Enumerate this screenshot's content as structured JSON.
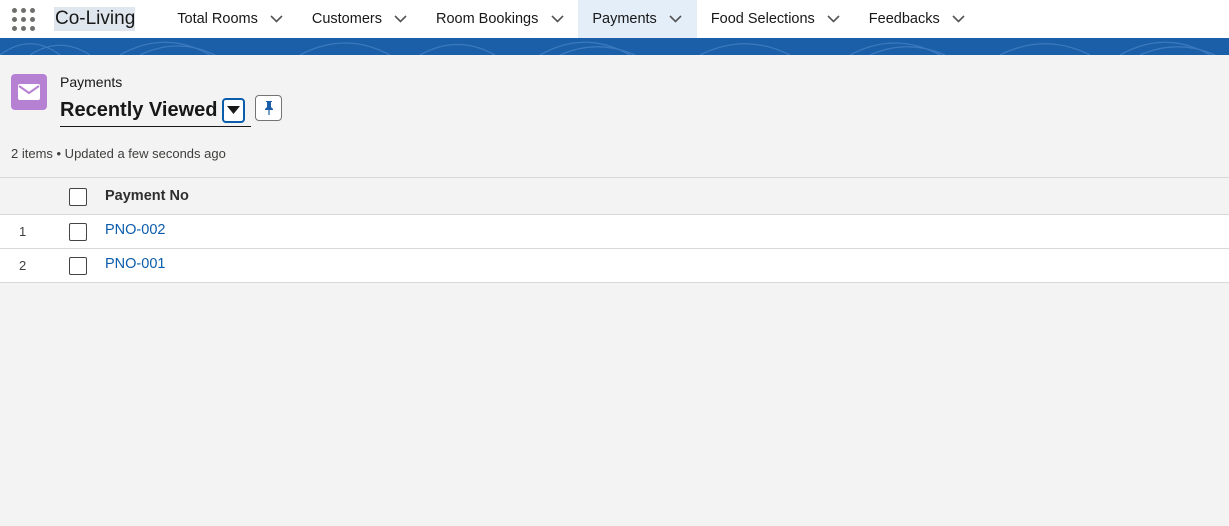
{
  "app": {
    "name": "Co-Living",
    "launcher_icon": "app-launcher-grid-icon"
  },
  "nav": {
    "tabs": [
      {
        "label": "Total Rooms",
        "active": false
      },
      {
        "label": "Customers",
        "active": false
      },
      {
        "label": "Room Bookings",
        "active": false
      },
      {
        "label": "Payments",
        "active": true
      },
      {
        "label": "Food Selections",
        "active": false
      },
      {
        "label": "Feedbacks",
        "active": false
      }
    ],
    "tab_menu_icon": "chevron-down-icon",
    "active_bg": "#e3eef9"
  },
  "brand": {
    "band_color": "#1b5fa8"
  },
  "header": {
    "object_label": "Payments",
    "object_icon": "envelope-icon",
    "object_icon_color": "#b781d3",
    "list_view_name": "Recently Viewed",
    "list_view_switch_icon": "caret-down-icon",
    "pin_icon": "pin-icon",
    "status": "2 items • Updated a few seconds ago"
  },
  "table": {
    "columns": [
      "Payment No"
    ],
    "rows": [
      {
        "number": "1",
        "payment_no": "PNO-002"
      },
      {
        "number": "2",
        "payment_no": "PNO-001"
      }
    ],
    "link_color": "#0b5cab"
  }
}
